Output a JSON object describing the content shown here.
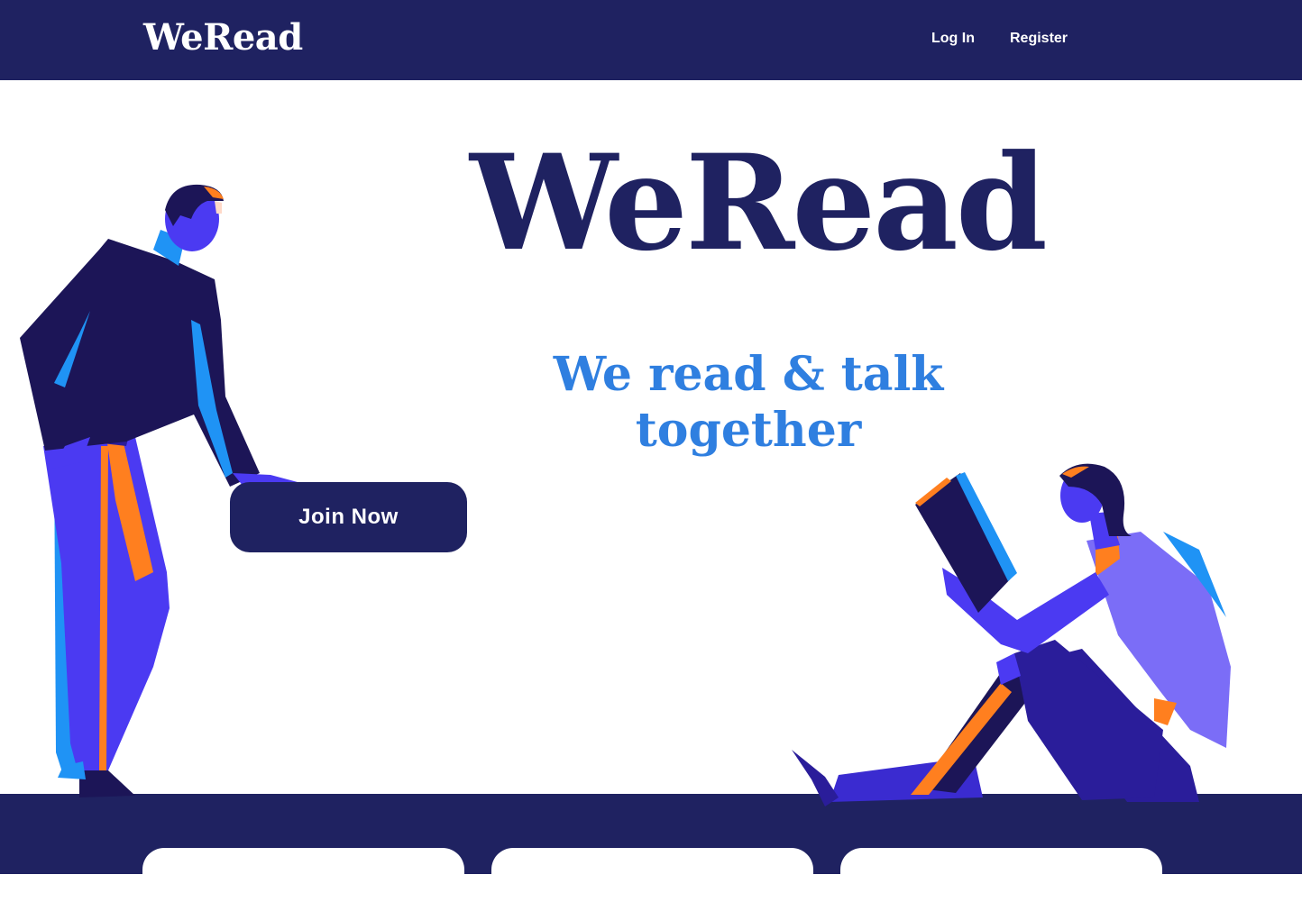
{
  "navbar": {
    "brand": "WeRead",
    "links": [
      "Log In",
      "Register"
    ]
  },
  "hero": {
    "title": "WeRead",
    "tagline": "We read & talk together",
    "join_label": "Join Now"
  },
  "illustrations": {
    "left": "man-leaning-icon",
    "right": "woman-reading-icon"
  },
  "colors": {
    "navy": "#1f2261",
    "accent_blue": "#2f7fe0",
    "violet": "#4b3af2",
    "orange": "#ff7f1f",
    "sky": "#1f93f5"
  },
  "features": {
    "cards": 3
  }
}
